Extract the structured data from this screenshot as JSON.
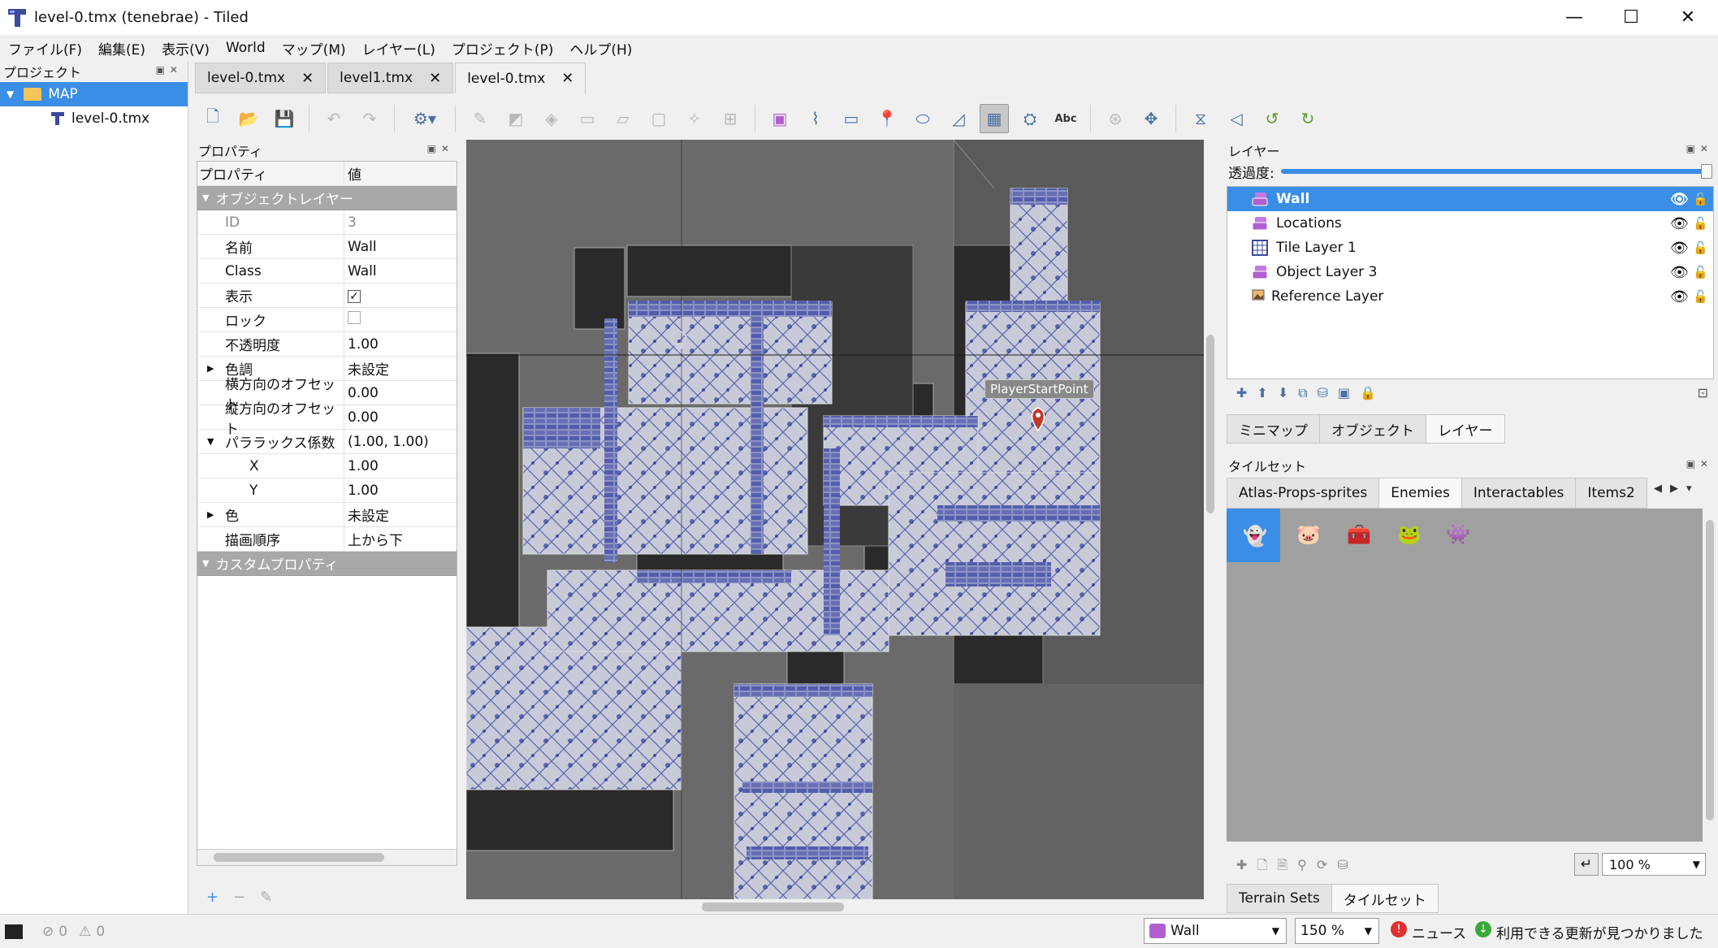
{
  "window": {
    "title": "level-0.tmx (tenebrae) - Tiled",
    "minimize": "—",
    "maximize": "☐",
    "close": "✕"
  },
  "menu": [
    "ファイル(F)",
    "編集(E)",
    "表示(V)",
    "World",
    "マップ(M)",
    "レイヤー(L)",
    "プロジェクト(P)",
    "ヘルプ(H)"
  ],
  "project_panel": {
    "title": "プロジェクト",
    "folder": "MAP",
    "file": "level-0.tmx"
  },
  "doc_tabs": [
    "level-0.tmx",
    "level1.tmx",
    "level-0.tmx"
  ],
  "properties": {
    "title": "プロパティ",
    "col_key": "プロパティ",
    "col_value": "値",
    "group_object_layer": "オブジェクトレイヤー",
    "rows": {
      "id": {
        "k": "ID",
        "v": "3"
      },
      "name": {
        "k": "名前",
        "v": "Wall"
      },
      "class": {
        "k": "Class",
        "v": "Wall"
      },
      "visible": {
        "k": "表示"
      },
      "locked": {
        "k": "ロック"
      },
      "opacity": {
        "k": "不透明度",
        "v": "1.00"
      },
      "tint": {
        "k": "色調",
        "v": "未設定"
      },
      "offset_x": {
        "k": "横方向のオフセット",
        "v": "0.00"
      },
      "offset_y": {
        "k": "縦方向のオフセット",
        "v": "0.00"
      },
      "parallax": {
        "k": "パララックス係数",
        "v": "(1.00, 1.00)"
      },
      "px": {
        "k": "X",
        "v": "1.00"
      },
      "py": {
        "k": "Y",
        "v": "1.00"
      },
      "color": {
        "k": "色",
        "v": "未設定"
      },
      "draw_order": {
        "k": "描画順序",
        "v": "上から下"
      }
    },
    "group_custom": "カスタムプロパティ"
  },
  "canvas": {
    "marker_label": "PlayerStartPoint"
  },
  "layers": {
    "title": "レイヤー",
    "opacity_label": "透過度:",
    "items": [
      "Wall",
      "Locations",
      "Tile Layer 1",
      "Object Layer 3",
      "Reference Layer"
    ],
    "bottom_tabs": [
      "ミニマップ",
      "オブジェクト",
      "レイヤー"
    ]
  },
  "tilesets": {
    "title": "タイルセット",
    "tabs": [
      "Atlas-Props-sprites",
      "Enemies",
      "Interactables",
      "Items2"
    ],
    "zoom": "100 %",
    "bottom_tabs": [
      "Terrain Sets",
      "タイルセット"
    ]
  },
  "status": {
    "errors": "0",
    "warnings": "0",
    "layer": "Wall",
    "zoom": "150 %",
    "news": "ニュース",
    "update": "利用できる更新が見つかりました"
  },
  "colors": {
    "accent": "#3a8ee6",
    "object_icon": "#b05fd0",
    "tile_blue": "#2b3a9c"
  }
}
